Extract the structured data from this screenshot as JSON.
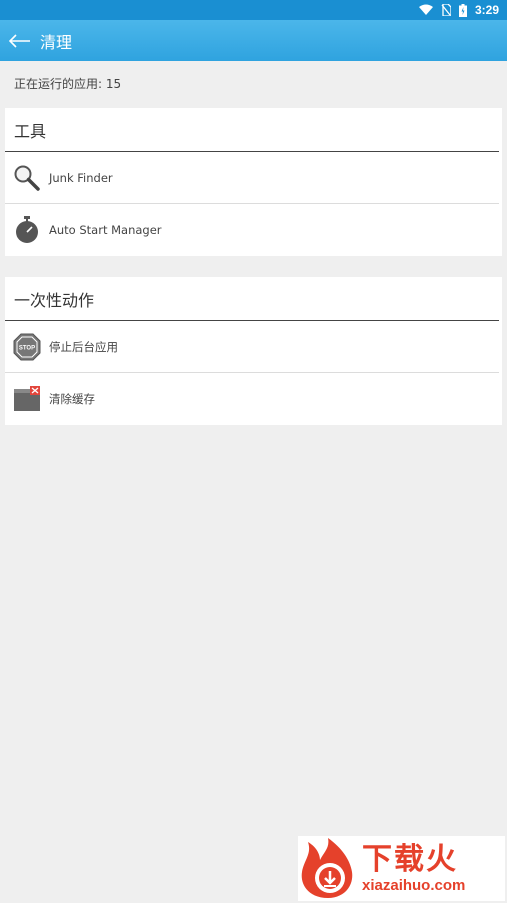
{
  "status_bar": {
    "time": "3:29"
  },
  "app_bar": {
    "title": "清理"
  },
  "running_apps": {
    "text": "正在运行的应用: 15"
  },
  "tools": {
    "header": "工具",
    "items": [
      {
        "label": "Junk Finder",
        "icon": "search-icon"
      },
      {
        "label": "Auto Start Manager",
        "icon": "stopwatch-icon"
      }
    ]
  },
  "actions": {
    "header": "一次性动作",
    "items": [
      {
        "label": "停止后台应用",
        "icon": "stop-sign-icon",
        "icon_text": "STOP"
      },
      {
        "label": "清除缓存",
        "icon": "window-close-icon"
      }
    ]
  },
  "watermark": {
    "cn": "下载火",
    "en": "xiazaihuo.com"
  },
  "colors": {
    "app_bar": "#2fa3df",
    "status_bar": "#1a8fd2",
    "background": "#efefef",
    "watermark": "#e5412b"
  }
}
